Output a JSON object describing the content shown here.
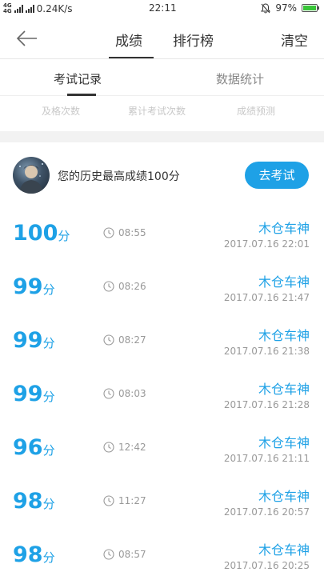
{
  "status_bar": {
    "network": "4G",
    "network2": "4G",
    "speed": "0.24K/s",
    "time": "22:11",
    "battery": "97%",
    "battery_level": 0.97
  },
  "nav": {
    "tabs": [
      "成绩",
      "排行榜"
    ],
    "clear": "清空"
  },
  "subtabs": [
    "考试记录",
    "数据统计"
  ],
  "stats": [
    "及格次数",
    "累计考试次数",
    "成绩预测"
  ],
  "profile": {
    "best_text": "您的历史最高成绩100分",
    "exam_button": "去考试"
  },
  "score_unit": "分",
  "records": [
    {
      "score": "100",
      "duration": "08:55",
      "name": "木仓车神",
      "datetime": "2017.07.16  22:01"
    },
    {
      "score": "99",
      "duration": "08:26",
      "name": "木仓车神",
      "datetime": "2017.07.16  21:47"
    },
    {
      "score": "99",
      "duration": "08:27",
      "name": "木仓车神",
      "datetime": "2017.07.16  21:38"
    },
    {
      "score": "99",
      "duration": "08:03",
      "name": "木仓车神",
      "datetime": "2017.07.16  21:28"
    },
    {
      "score": "96",
      "duration": "12:42",
      "name": "木仓车神",
      "datetime": "2017.07.16  21:11"
    },
    {
      "score": "98",
      "duration": "11:27",
      "name": "木仓车神",
      "datetime": "2017.07.16  20:57"
    },
    {
      "score": "98",
      "duration": "08:57",
      "name": "木仓车神",
      "datetime": "2017.07.16  20:25"
    }
  ],
  "icons": {
    "back": "arrow-left-icon",
    "clock": "clock-icon",
    "silent": "bell-off-icon",
    "battery": "battery-icon"
  },
  "colors": {
    "accent": "#1ea1e6",
    "muted": "#999999",
    "battery_fill": "#39c539"
  }
}
